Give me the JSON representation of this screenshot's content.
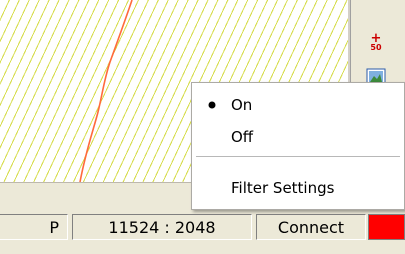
{
  "canvas": {
    "hatch_color": "#d6dc4a",
    "trace_color": "#ff6a3c"
  },
  "toolbar": {
    "tools": [
      {
        "icon": "add-point-icon",
        "text": "+",
        "subtext": "50"
      },
      {
        "icon": "map-icon"
      }
    ]
  },
  "context_menu": {
    "items": [
      {
        "label": "On",
        "checked": true
      },
      {
        "label": "Off",
        "checked": false
      },
      {
        "label": "Filter Settings",
        "checked": false
      }
    ]
  },
  "status_bar": {
    "left_fragment": "P",
    "coordinates": "11524 : 2048",
    "connection": "Connect",
    "indicator_color": "#ff0000"
  }
}
